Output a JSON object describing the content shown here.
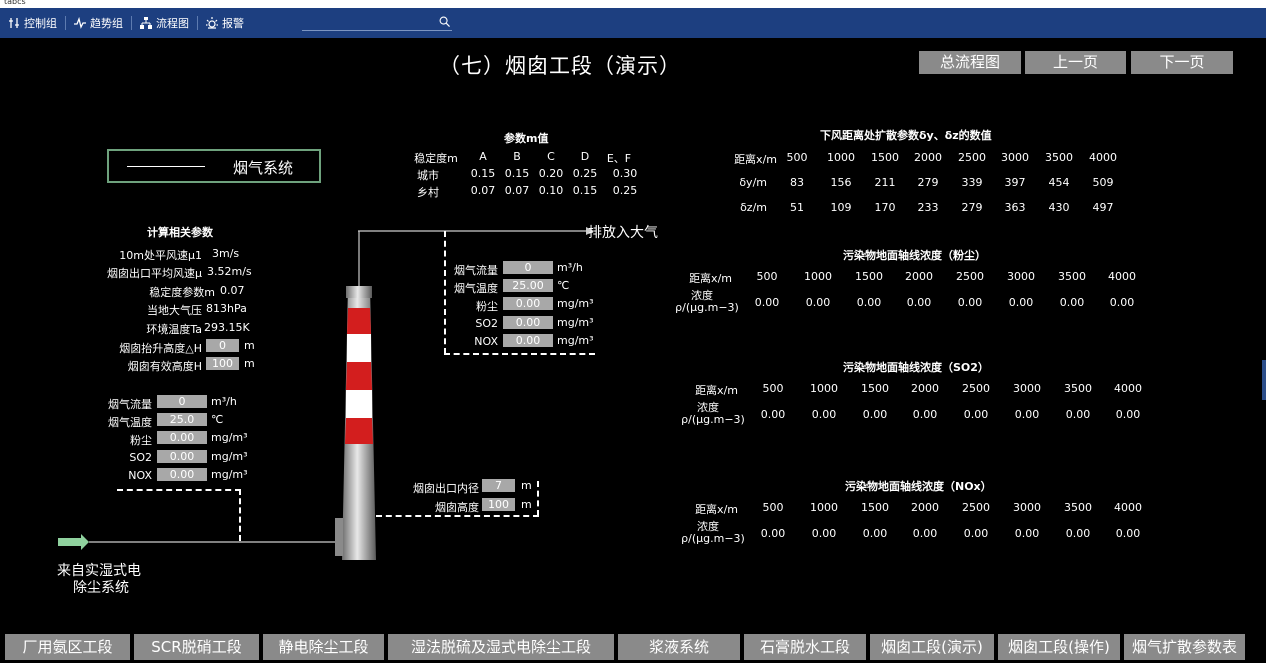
{
  "window": {
    "title": "tabcs"
  },
  "toolbar": {
    "items": [
      {
        "label": "控制组",
        "icon": "sliders-icon"
      },
      {
        "label": "趋势组",
        "icon": "trend-icon"
      },
      {
        "label": "流程图",
        "icon": "flow-icon"
      },
      {
        "label": "报警",
        "icon": "alarm-icon"
      }
    ],
    "search_placeholder": ""
  },
  "page": {
    "title": "（七）烟囱工段（演示）",
    "nav": {
      "overview": "总流程图",
      "prev": "上一页",
      "next": "下一页"
    }
  },
  "flue_system": {
    "title": "烟气系统"
  },
  "calc_params": {
    "title": "计算相关参数",
    "rows": [
      {
        "label": "10m处平风速μ1",
        "value": "3m/s"
      },
      {
        "label": "烟囱出口平均风速μ",
        "value": "3.52m/s"
      },
      {
        "label": "稳定度参数m",
        "value": "0.07"
      },
      {
        "label": "当地大气压",
        "value": "813hPa"
      },
      {
        "label": "环境温度Ta",
        "value": "293.15K"
      }
    ],
    "inputs": [
      {
        "label": "烟囱抬升高度△H",
        "value": "0",
        "unit": "m"
      },
      {
        "label": "烟囱有效高度H",
        "value": "100",
        "unit": "m"
      }
    ]
  },
  "flue_left": [
    {
      "label": "烟气流量",
      "value": "0",
      "unit": "m³/h"
    },
    {
      "label": "烟气温度",
      "value": "25.0",
      "unit": "℃"
    },
    {
      "label": "粉尘",
      "value": "0.00",
      "unit": "mg/m³"
    },
    {
      "label": "SO2",
      "value": "0.00",
      "unit": "mg/m³"
    },
    {
      "label": "NOX",
      "value": "0.00",
      "unit": "mg/m³"
    }
  ],
  "flue_mid": [
    {
      "label": "烟气流量",
      "value": "0",
      "unit": "m³/h"
    },
    {
      "label": "烟气温度",
      "value": "25.00",
      "unit": "℃"
    },
    {
      "label": "粉尘",
      "value": "0.00",
      "unit": "mg/m³"
    },
    {
      "label": "SO2",
      "value": "0.00",
      "unit": "mg/m³"
    },
    {
      "label": "NOX",
      "value": "0.00",
      "unit": "mg/m³"
    }
  ],
  "chimney": {
    "outlet_label": "烟囱出口内径",
    "outlet_value": "7",
    "outlet_unit": "m",
    "height_label": "烟囱高度",
    "height_value": "100",
    "height_unit": "m",
    "exhaust_label": "排放入大气",
    "source_label_1": "来自实湿式电",
    "source_label_2": "除尘系统"
  },
  "m_table": {
    "title": "参数m值",
    "header": [
      "稳定度m",
      "A",
      "B",
      "C",
      "D",
      "E、F"
    ],
    "rows": [
      [
        "城市",
        "0.15",
        "0.15",
        "0.20",
        "0.25",
        "0.30"
      ],
      [
        "乡村",
        "0.07",
        "0.07",
        "0.10",
        "0.15",
        "0.25"
      ]
    ]
  },
  "diffusion": {
    "title": "下风距离处扩散参数δy、δz的数值",
    "rows": [
      {
        "label": "距离x/m",
        "values": [
          "500",
          "1000",
          "1500",
          "2000",
          "2500",
          "3000",
          "3500",
          "4000"
        ]
      },
      {
        "label": "δy/m",
        "values": [
          "83",
          "156",
          "211",
          "279",
          "339",
          "397",
          "454",
          "509"
        ]
      },
      {
        "label": "δz/m",
        "values": [
          "51",
          "109",
          "170",
          "233",
          "279",
          "363",
          "430",
          "497"
        ]
      }
    ]
  },
  "conc_tables": [
    {
      "title": "污染物地面轴线浓度（粉尘）",
      "dist_label": "距离x/m",
      "conc_label_1": "浓度",
      "conc_label_2": "ρ/(μg.m−3)",
      "distances": [
        "500",
        "1000",
        "1500",
        "2000",
        "2500",
        "3000",
        "3500",
        "4000"
      ],
      "values": [
        "0.00",
        "0.00",
        "0.00",
        "0.00",
        "0.00",
        "0.00",
        "0.00",
        "0.00"
      ]
    },
    {
      "title": "污染物地面轴线浓度（SO2）",
      "dist_label": "距离x/m",
      "conc_label_1": "浓度",
      "conc_label_2": "ρ/(μg.m−3)",
      "distances": [
        "500",
        "1000",
        "1500",
        "2000",
        "2500",
        "3000",
        "3500",
        "4000"
      ],
      "values": [
        "0.00",
        "0.00",
        "0.00",
        "0.00",
        "0.00",
        "0.00",
        "0.00",
        "0.00"
      ]
    },
    {
      "title": "污染物地面轴线浓度（NOx）",
      "dist_label": "距离x/m",
      "conc_label_1": "浓度",
      "conc_label_2": "ρ/(μg.m−3)",
      "distances": [
        "500",
        "1000",
        "1500",
        "2000",
        "2500",
        "3000",
        "3500",
        "4000"
      ],
      "values": [
        "0.00",
        "0.00",
        "0.00",
        "0.00",
        "0.00",
        "0.00",
        "0.00",
        "0.00"
      ]
    }
  ],
  "bottom_nav": [
    "厂用氨区工段",
    "SCR脱硝工段",
    "静电除尘工段",
    "湿法脱硫及湿式电除尘工段",
    "浆液系统",
    "石膏脱水工段",
    "烟囱工段(演示)",
    "烟囱工段(操作)",
    "烟气扩散参数表"
  ],
  "colors": {
    "toolbar": "#1d3f80",
    "button": "#8a8a8a",
    "value_box": "#a8a8a8",
    "chimney_red": "#d31e1e",
    "arrow_green": "#8fd19e",
    "frame_green": "#6ea27d"
  }
}
